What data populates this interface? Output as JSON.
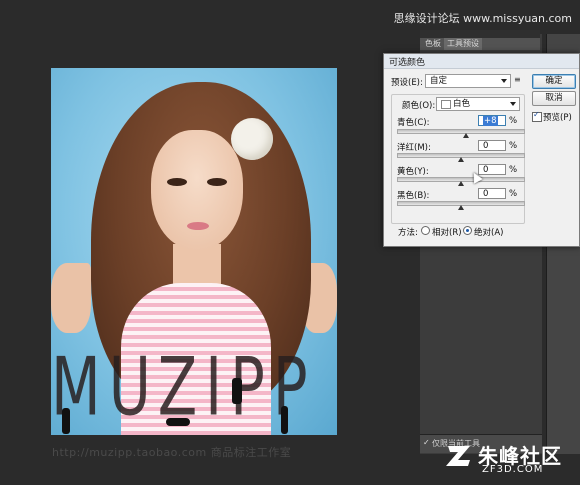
{
  "site_header": {
    "text": "思缘设计论坛 www.missyuan.com"
  },
  "canvas": {
    "watermark_text": "MUZIPP",
    "url_text": "http://muzipp.taobao.com 商品标注工作室"
  },
  "panel": {
    "tabs": [
      "色板",
      "工具预设"
    ],
    "bottom_checkbox_label": "仅限当前工具"
  },
  "dialog": {
    "title": "可选颜色",
    "preset_label": "预设(E):",
    "preset_value": "自定",
    "colors_label": "颜色(O):",
    "colors_value": "白色",
    "buttons": {
      "ok": "确定",
      "cancel": "取消"
    },
    "preview": {
      "label": "预览(P)",
      "checked": true
    },
    "sliders": [
      {
        "label": "青色(C):",
        "value": "+8",
        "percent": "%",
        "position": 0.54
      },
      {
        "label": "洋红(M):",
        "value": "0",
        "percent": "%",
        "position": 0.5
      },
      {
        "label": "黄色(Y):",
        "value": "0",
        "percent": "%",
        "position": 0.5
      },
      {
        "label": "黑色(B):",
        "value": "0",
        "percent": "%",
        "position": 0.5
      }
    ],
    "method": {
      "label": "方法:",
      "relative": "相对(R)",
      "absolute": "绝对(A)",
      "selected": "absolute"
    }
  },
  "logo": {
    "name": "朱峰社区",
    "domain": "ZF3D.COM"
  },
  "colors": {
    "workspace": "#2b2b2b",
    "dialog_bg": "#f0f0f0",
    "accent": "#3c7fb1"
  }
}
